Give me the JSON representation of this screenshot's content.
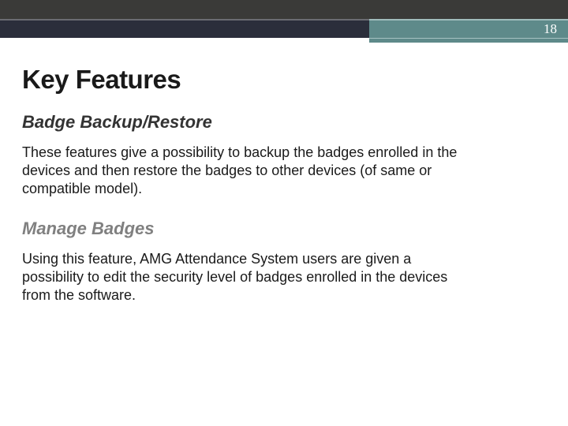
{
  "page_number": "18",
  "title": "Key Features",
  "sections": [
    {
      "heading": "Badge Backup/Restore",
      "body": "These features give a possibility to backup the badges enrolled in the devices and then restore the badges to other devices (of same or compatible model)."
    },
    {
      "heading": "Manage Badges",
      "body": "Using this feature, AMG Attendance System users are given a possibility to edit the security level of  badges enrolled in the devices from the software."
    }
  ]
}
